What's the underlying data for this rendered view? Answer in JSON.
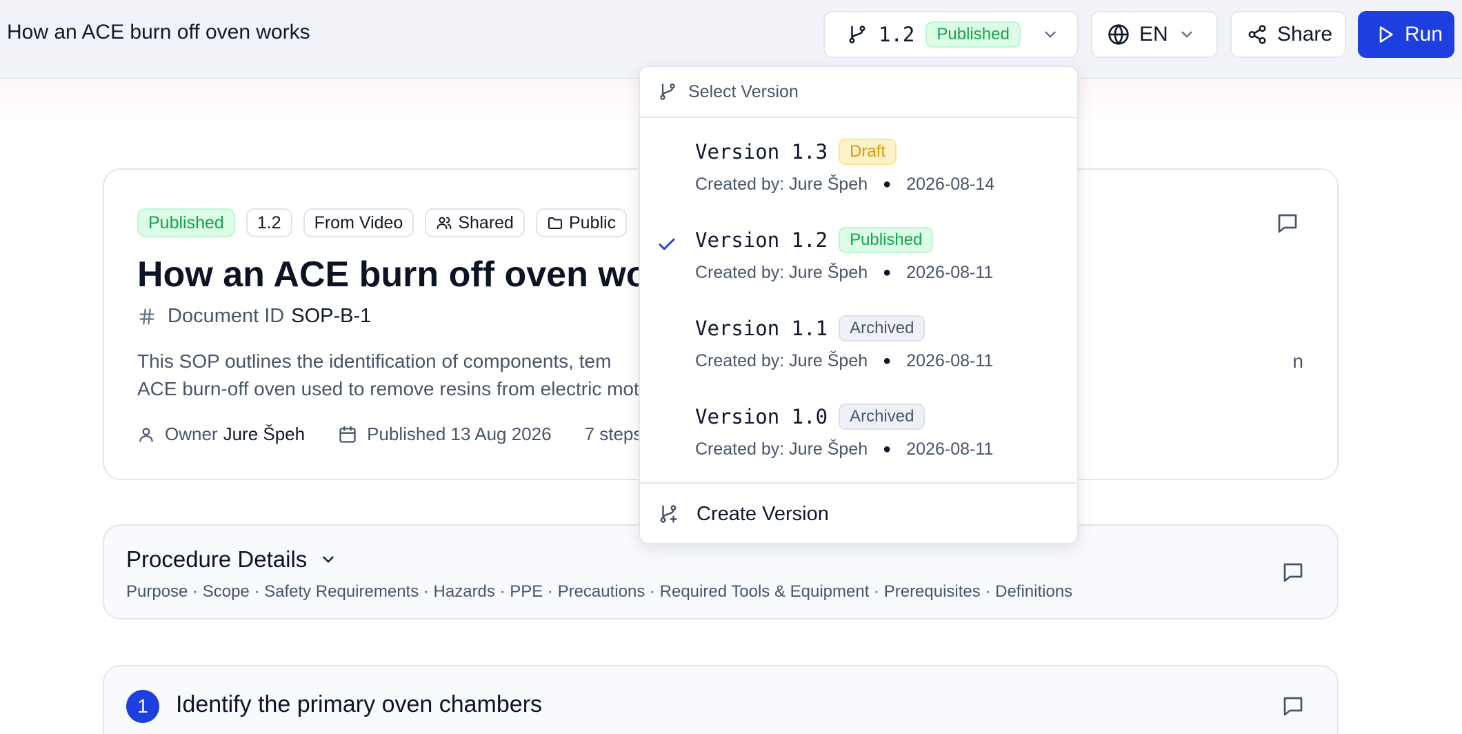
{
  "header": {
    "title": "How an ACE burn off oven works",
    "version_number": "1.2",
    "version_status": "Published",
    "language": "EN",
    "share_label": "Share",
    "run_label": "Run"
  },
  "document": {
    "chips": {
      "status": "Published",
      "version": "1.2",
      "source": "From Video",
      "sharing": "Shared",
      "visibility": "Public"
    },
    "title": "How an ACE burn off oven works",
    "doc_id_label": "Document ID",
    "doc_id_value": "SOP-B-1",
    "description": "This SOP outlines the identification of components, tem                                                                                                                               n ACE burn-off oven used to remove resins from electric motors.",
    "owner_label": "Owner",
    "owner_name": "Jure Špeh",
    "published_label": "Published 13 Aug 2026",
    "steps_label": "7 steps"
  },
  "procedure_details": {
    "title": "Procedure Details",
    "sections": "Purpose · Scope · Safety Requirements · Hazards · PPE · Precautions · Required Tools & Equipment · Prerequisites · Definitions"
  },
  "steps": [
    {
      "number": "1",
      "title": "Identify the primary oven chambers"
    }
  ],
  "version_dropdown": {
    "heading": "Select Version",
    "versions": [
      {
        "name": "Version 1.3",
        "status": "Draft",
        "created_by": "Created by: Jure Špeh",
        "date": "2026-08-14",
        "selected": false
      },
      {
        "name": "Version 1.2",
        "status": "Published",
        "created_by": "Created by: Jure Špeh",
        "date": "2026-08-11",
        "selected": true
      },
      {
        "name": "Version 1.1",
        "status": "Archived",
        "created_by": "Created by: Jure Špeh",
        "date": "2026-08-11",
        "selected": false
      },
      {
        "name": "Version 1.0",
        "status": "Archived",
        "created_by": "Created by: Jure Špeh",
        "date": "2026-08-11",
        "selected": false
      }
    ],
    "create_label": "Create Version"
  },
  "colors": {
    "primary": "#1d3fe0",
    "published_text": "#16a34a",
    "draft_text": "#d99a06",
    "archived_text": "#475569"
  }
}
